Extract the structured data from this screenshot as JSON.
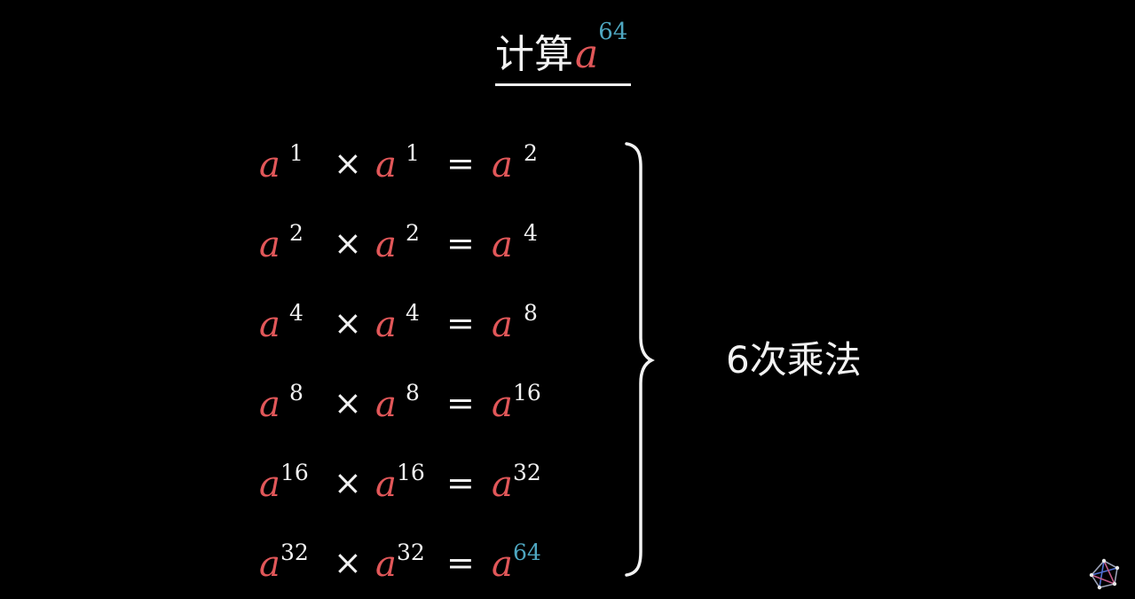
{
  "colors": {
    "background": "#000000",
    "base": "#e15759",
    "text": "#f2f2f2",
    "highlight": "#4ea7c1"
  },
  "title": {
    "prefix": "计算",
    "var": "a",
    "exp": "64"
  },
  "rows": [
    {
      "b1": "a",
      "e1": "1",
      "op": "×",
      "b2": "a",
      "e2": "1",
      "eq": "=",
      "b3": "a",
      "e3": "2"
    },
    {
      "b1": "a",
      "e1": "2",
      "op": "×",
      "b2": "a",
      "e2": "2",
      "eq": "=",
      "b3": "a",
      "e3": "4"
    },
    {
      "b1": "a",
      "e1": "4",
      "op": "×",
      "b2": "a",
      "e2": "4",
      "eq": "=",
      "b3": "a",
      "e3": "8"
    },
    {
      "b1": "a",
      "e1": "8",
      "op": "×",
      "b2": "a",
      "e2": "8",
      "eq": "=",
      "b3": "a",
      "e3": "16"
    },
    {
      "b1": "a",
      "e1": "16",
      "op": "×",
      "b2": "a",
      "e2": "16",
      "eq": "=",
      "b3": "a",
      "e3": "32"
    },
    {
      "b1": "a",
      "e1": "32",
      "op": "×",
      "b2": "a",
      "e2": "32",
      "eq": "=",
      "b3": "a",
      "e3": "64"
    }
  ],
  "label": "6次乘法",
  "logo_icon": "channel-logo-icon"
}
